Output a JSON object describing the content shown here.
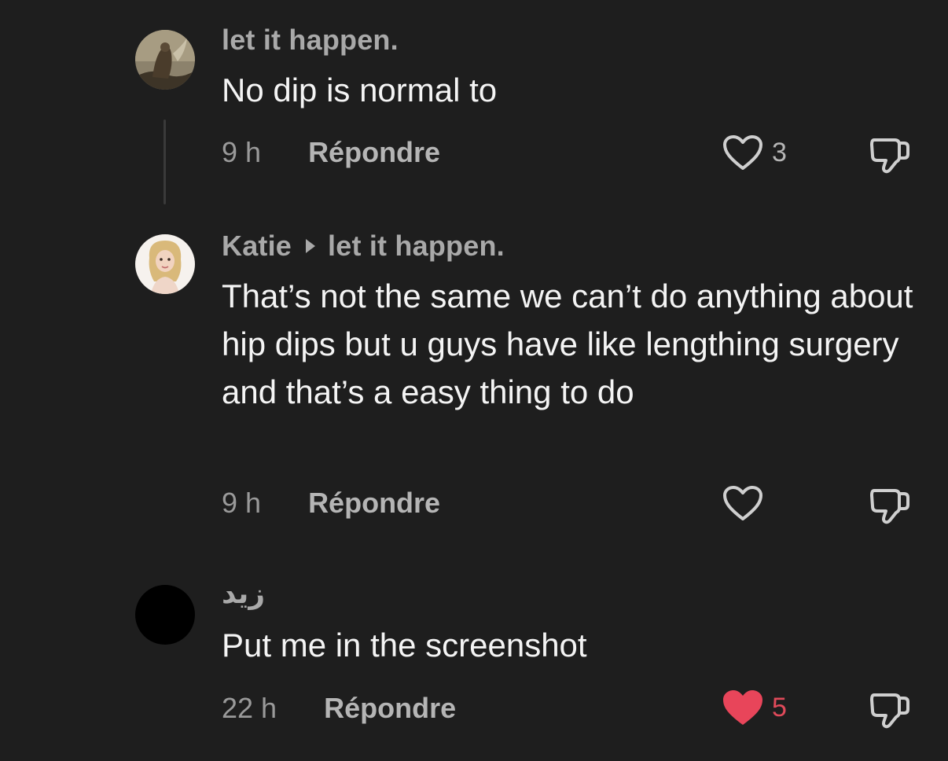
{
  "comments": [
    {
      "username": "let it happen.",
      "text": "No dip is normal to",
      "time": "9 h",
      "reply_label": "Répondre",
      "likes": "3",
      "liked": false
    },
    {
      "username": "Katie",
      "reply_to": "let it happen.",
      "text": "That’s not the same we can’t do anything about hip dips but u guys have like lengthing surgery and that’s a easy thing to do",
      "time": "9 h",
      "reply_label": "Répondre",
      "likes": "",
      "liked": false
    },
    {
      "username": "زيد",
      "text": "Put me in the screenshot",
      "time": "22 h",
      "reply_label": "Répondre",
      "likes": "5",
      "liked": true
    }
  ],
  "colors": {
    "background": "#1e1e1e",
    "username": "#a9a9a9",
    "liked_heart": "#e8455a"
  },
  "icons": {
    "like": "heart-outline-icon",
    "liked": "heart-filled-icon",
    "dislike": "thumbs-down-icon",
    "reply_arrow": "caret-right-icon"
  }
}
